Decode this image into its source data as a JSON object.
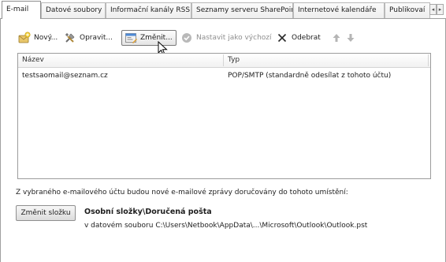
{
  "tabs": [
    {
      "label": "E-mail",
      "active": true
    },
    {
      "label": "Datové soubory",
      "active": false
    },
    {
      "label": "Informační kanály RSS",
      "active": false
    },
    {
      "label": "Seznamy serveru SharePoint",
      "active": false
    },
    {
      "label": "Internetové kalendáře",
      "active": false
    },
    {
      "label": "Publikovaí",
      "active": false
    }
  ],
  "tab_scroll": {
    "left_icon": "tab-scroll-left-icon",
    "right_icon": "tab-scroll-right-icon"
  },
  "toolbar": {
    "new_label": "Nový...",
    "repair_label": "Opravit...",
    "change_label": "Změnit...",
    "set_default_label": "Nastavit jako výchozí",
    "remove_label": "Odebrat",
    "move_up_icon": "arrow-up-icon",
    "move_down_icon": "arrow-down-icon"
  },
  "list": {
    "columns": [
      "Název",
      "Typ"
    ],
    "rows": [
      {
        "name": "testsaomail@seznam.cz",
        "type": "POP/SMTP (standardně odesílat z tohoto účtu)"
      }
    ]
  },
  "delivery": {
    "info": "Z vybraného e-mailového účtu budou nové e-mailové zprávy doručovány do tohoto umístění:",
    "change_folder_label": "Změnit složku",
    "folder_path": "Osobní složky\\Doručená pošta",
    "data_file": "v datovém souboru C:\\Users\\Netbook\\AppData\\...\\Microsoft\\Outlook\\Outlook.pst"
  },
  "colors": {
    "accent": "#2b6fc8",
    "border": "#a0a0a0",
    "disabled": "#8f8f8f"
  }
}
